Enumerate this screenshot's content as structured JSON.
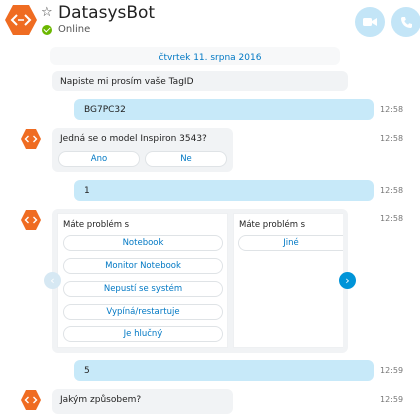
{
  "header": {
    "name": "DatasysBot",
    "status": "Online",
    "accent": "#ef6c22"
  },
  "date_divider": "čtvrtek 11. srpna 2016",
  "messages": {
    "m1": {
      "text": "Napiste mi prosím vaše TagID"
    },
    "m2": {
      "text": "BG7PC32",
      "time": "12:58"
    },
    "m3": {
      "text": "Jedná se o model Inspiron 3543?",
      "time": "12:58",
      "choices": [
        "Ano",
        "Ne"
      ]
    },
    "m4": {
      "text": "1",
      "time": "12:58"
    },
    "m5": {
      "time": "12:58",
      "card1": {
        "title": "Máte problém s",
        "options": [
          "Notebook",
          "Monitor Notebook",
          "Nepustí se systém",
          "Vypíná/restartuje",
          "Je hlučný"
        ]
      },
      "card2": {
        "title": "Máte problém s",
        "options": [
          "Jiné"
        ]
      }
    },
    "m6": {
      "text": "5",
      "time": "12:59"
    },
    "m7": {
      "text": "Jakým způsobem?",
      "time": "12:59"
    }
  },
  "icons": {
    "bot_avatar": "hexagon-code-icon",
    "video": "video-camera-icon",
    "phone": "phone-icon",
    "star": "star-icon",
    "nav_left": "chevron-left-icon",
    "nav_right": "chevron-right-icon"
  }
}
